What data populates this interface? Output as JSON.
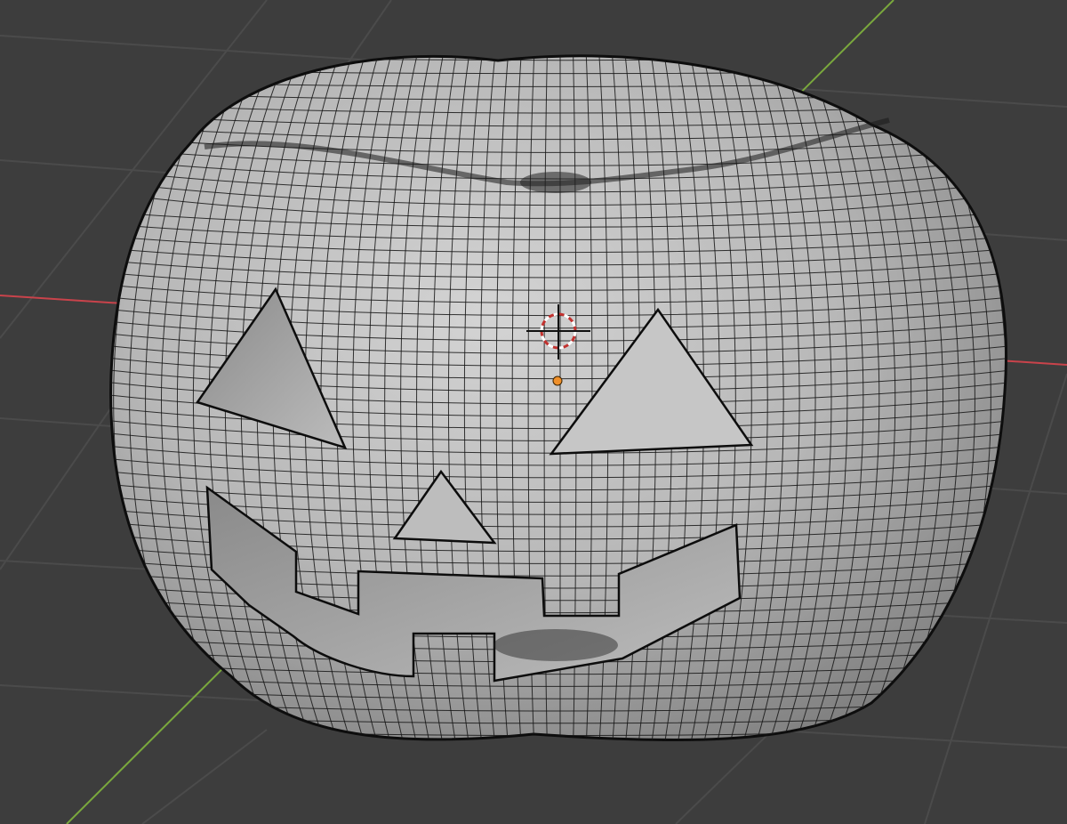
{
  "viewport": {
    "type": "blender-3d-viewport",
    "mode": "wireframe-overlay",
    "background_color": "#3d3d3d",
    "grid_color": "#4a4a4a",
    "axis_x_color": "#c9434b",
    "axis_y_color": "#7aa83d",
    "mesh_color": "#b9b9b9",
    "wire_color": "#111111",
    "origin_color": "#f0902a",
    "cursor_color": "#c2322f"
  },
  "object": {
    "name": "pumpkin",
    "features": [
      "left-eye",
      "right-eye",
      "nose",
      "mouth",
      "stem-dimple",
      "bottom-dimple"
    ]
  },
  "icons": [
    "3d-cursor-icon",
    "object-origin-icon"
  ]
}
